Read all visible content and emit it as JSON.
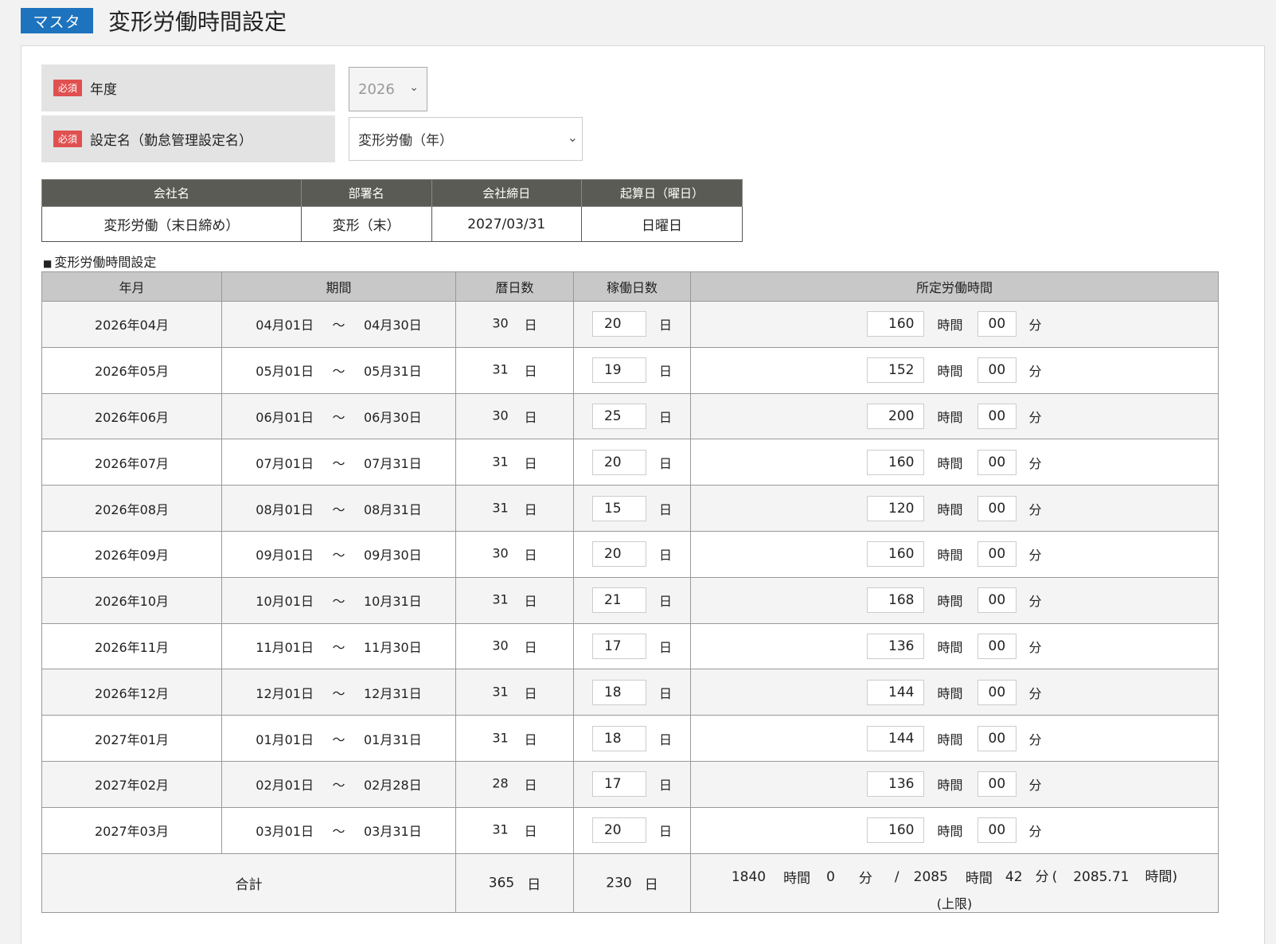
{
  "header": {
    "badge": "マスタ",
    "title": "変形労働時間設定"
  },
  "form": {
    "required_label": "必須",
    "year_label": "年度",
    "year_value": "2026",
    "setting_label": "設定名（勤怠管理設定名）",
    "setting_value": "変形労働（年）"
  },
  "info": {
    "headers": [
      "会社名",
      "部署名",
      "会社締日",
      "起算日（曜日）"
    ],
    "values": [
      "変形労働（末日締め）",
      "変形（末）",
      "2027/03/31",
      "日曜日"
    ]
  },
  "section_title": "変形労働時間設定",
  "table": {
    "headers": [
      "年月",
      "期間",
      "暦日数",
      "稼働日数",
      "所定労働時間"
    ],
    "tilde": "〜",
    "day_unit": "日",
    "hour_unit": "時間",
    "min_unit": "分",
    "rows": [
      {
        "ym": "2026年04月",
        "from": "04月01日",
        "to": "04月30日",
        "cal": "30",
        "work": "20",
        "hours": "160",
        "mins": "00"
      },
      {
        "ym": "2026年05月",
        "from": "05月01日",
        "to": "05月31日",
        "cal": "31",
        "work": "19",
        "hours": "152",
        "mins": "00"
      },
      {
        "ym": "2026年06月",
        "from": "06月01日",
        "to": "06月30日",
        "cal": "30",
        "work": "25",
        "hours": "200",
        "mins": "00"
      },
      {
        "ym": "2026年07月",
        "from": "07月01日",
        "to": "07月31日",
        "cal": "31",
        "work": "20",
        "hours": "160",
        "mins": "00"
      },
      {
        "ym": "2026年08月",
        "from": "08月01日",
        "to": "08月31日",
        "cal": "31",
        "work": "15",
        "hours": "120",
        "mins": "00"
      },
      {
        "ym": "2026年09月",
        "from": "09月01日",
        "to": "09月30日",
        "cal": "30",
        "work": "20",
        "hours": "160",
        "mins": "00"
      },
      {
        "ym": "2026年10月",
        "from": "10月01日",
        "to": "10月31日",
        "cal": "31",
        "work": "21",
        "hours": "168",
        "mins": "00"
      },
      {
        "ym": "2026年11月",
        "from": "11月01日",
        "to": "11月30日",
        "cal": "30",
        "work": "17",
        "hours": "136",
        "mins": "00"
      },
      {
        "ym": "2026年12月",
        "from": "12月01日",
        "to": "12月31日",
        "cal": "31",
        "work": "18",
        "hours": "144",
        "mins": "00"
      },
      {
        "ym": "2027年01月",
        "from": "01月01日",
        "to": "01月31日",
        "cal": "31",
        "work": "18",
        "hours": "144",
        "mins": "00"
      },
      {
        "ym": "2027年02月",
        "from": "02月01日",
        "to": "02月28日",
        "cal": "28",
        "work": "17",
        "hours": "136",
        "mins": "00"
      },
      {
        "ym": "2027年03月",
        "from": "03月01日",
        "to": "03月31日",
        "cal": "31",
        "work": "20",
        "hours": "160",
        "mins": "00"
      }
    ],
    "total": {
      "label": "合計",
      "cal": "365",
      "work": "230",
      "hours": "1840",
      "mins": "0",
      "slash": "/",
      "limit_hours": "2085",
      "limit_mins": "42",
      "limit_decimal": "2085.71",
      "paren_open": "(",
      "paren_close": "時間)",
      "limit_note": "(上限)"
    }
  }
}
